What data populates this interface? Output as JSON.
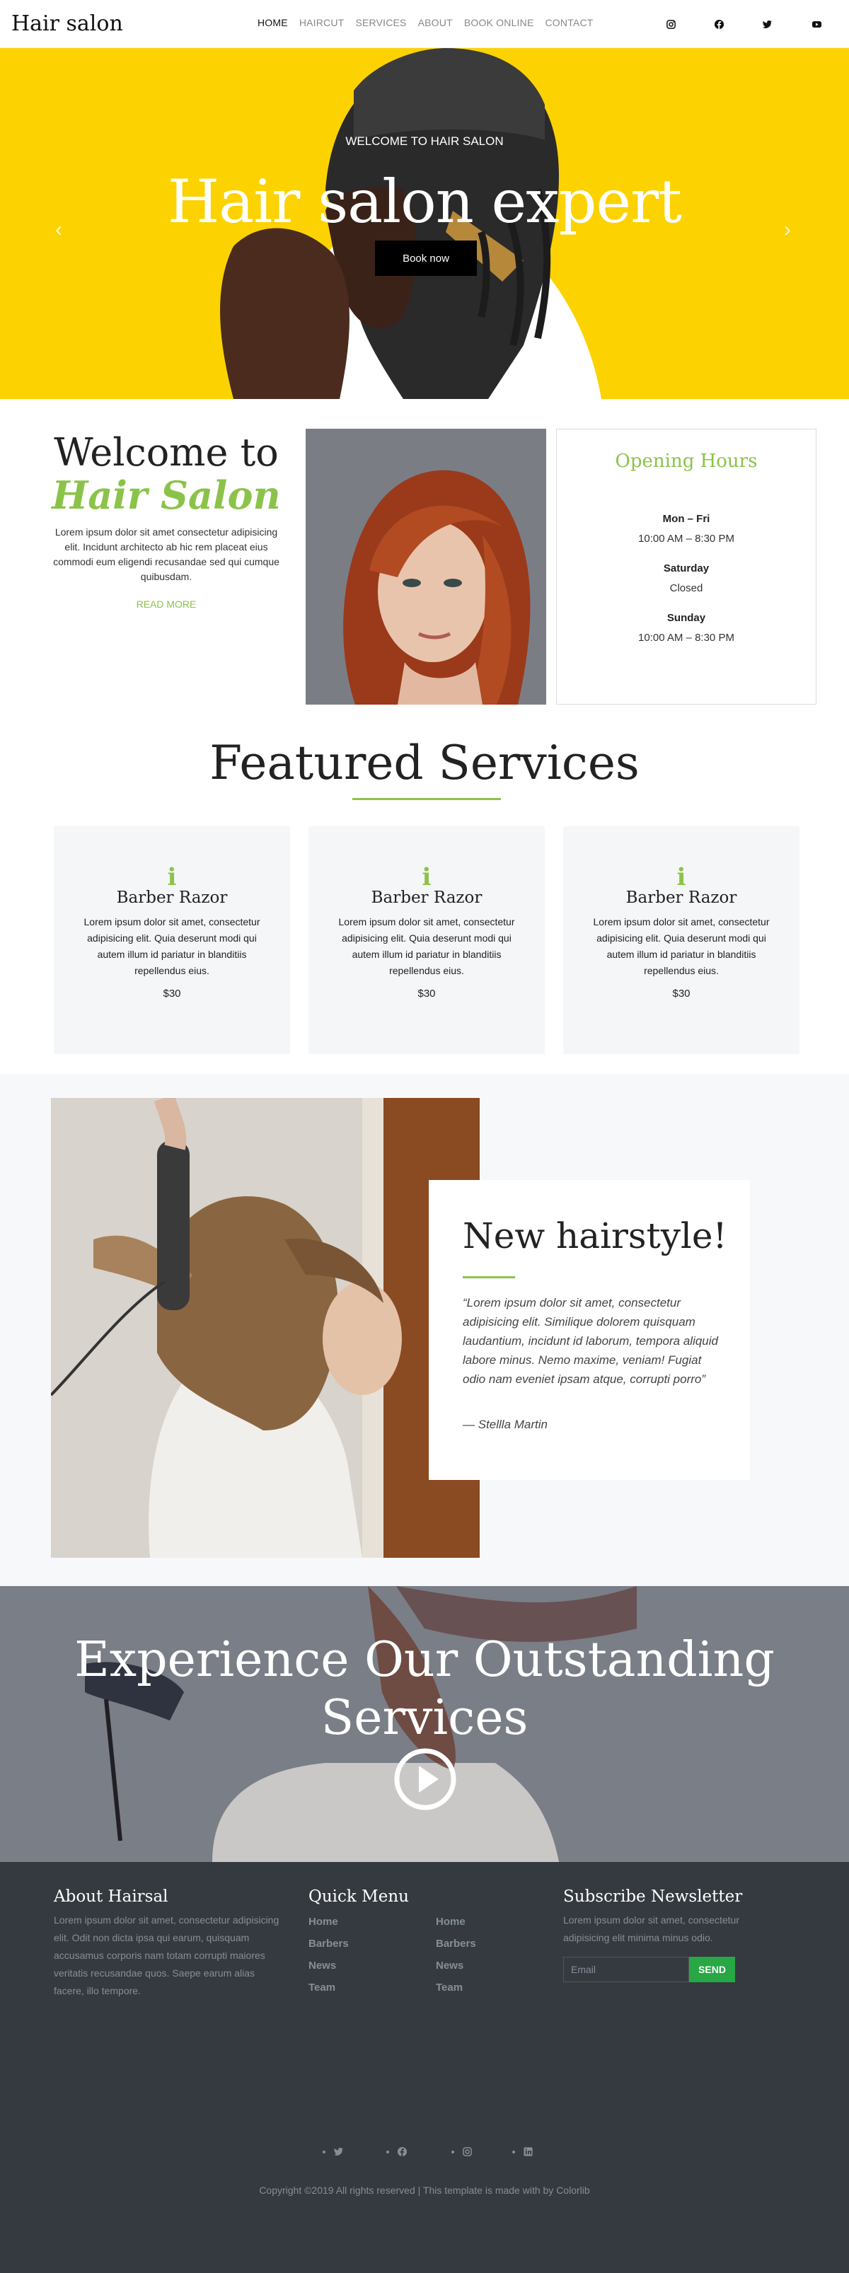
{
  "header": {
    "logo": "Hair salon",
    "nav": [
      "HOME",
      "HAIRCUT",
      "SERVICES",
      "ABOUT",
      "BOOK ONLINE",
      "CONTACT"
    ],
    "social_icons": [
      "instagram-icon",
      "facebook-icon",
      "twitter-icon",
      "youtube-icon"
    ]
  },
  "hero": {
    "subtitle": "WELCOME TO HAIR SALON",
    "title": "Hair salon expert",
    "button": "Book now",
    "prev": "‹",
    "next": "›",
    "background_color": "#fcd200"
  },
  "welcome": {
    "title_line1": "Welcome to",
    "title_line2": "Hair Salon",
    "text": "Lorem ipsum dolor sit amet consectetur adipisicing elit. Incidunt architecto ab hic rem placeat eius commodi eum eligendi recusandae sed qui cumque quibusdam.",
    "read_more": "READ MORE"
  },
  "hours": {
    "title": "Opening Hours",
    "rows": [
      {
        "day": "Mon – Fri",
        "time": "10:00 AM – 8:30 PM"
      },
      {
        "day": "Saturday",
        "time": "Closed"
      },
      {
        "day": "Sunday",
        "time": "10:00 AM – 8:30 PM"
      }
    ]
  },
  "featured": {
    "title": "Featured Services",
    "cards": [
      {
        "icon": "i",
        "title": "Barber Razor",
        "text": "Lorem ipsum dolor sit amet, consectetur adipisicing elit. Quia deserunt modi qui autem illum id pariatur in blanditiis repellendus eius.",
        "price": "$30"
      },
      {
        "icon": "i",
        "title": "Barber Razor",
        "text": "Lorem ipsum dolor sit amet, consectetur adipisicing elit. Quia deserunt modi qui autem illum id pariatur in blanditiis repellendus eius.",
        "price": "$30"
      },
      {
        "icon": "i",
        "title": "Barber Razor",
        "text": "Lorem ipsum dolor sit amet, consectetur adipisicing elit. Quia deserunt modi qui autem illum id pariatur in blanditiis repellendus eius.",
        "price": "$30"
      }
    ]
  },
  "new_style": {
    "title": "New hairstyle!",
    "quote": "“Lorem ipsum dolor sit amet, consectetur adipisicing elit. Similique dolorem quisquam laudantium, incidunt id laborum, tempora aliquid labore minus. Nemo maxime, veniam! Fugiat odio nam eveniet ipsam atque, corrupti porro”",
    "author": "— Stellla Martin"
  },
  "experience": {
    "title": "Experience Our Outstanding Services"
  },
  "footer": {
    "about_title": "About Hairsal",
    "about_text": "Lorem ipsum dolor sit amet, consectetur adipisicing elit. Odit non dicta ipsa qui earum, quisquam accusamus corporis nam totam corrupti maiores veritatis recusandae quos. Saepe earum alias facere, illo tempore.",
    "menu_title": "Quick Menu",
    "menu_col1": [
      "Home",
      "Barbers",
      "News",
      "Team"
    ],
    "menu_col2": [
      "Home",
      "Barbers",
      "News",
      "Team"
    ],
    "newsletter_title": "Subscribe Newsletter",
    "newsletter_text": "Lorem ipsum dolor sit amet, consectetur adipisicing elit minima minus odio.",
    "email_placeholder": "Email",
    "send": "SEND",
    "social_icons": [
      "twitter-icon",
      "facebook-icon",
      "instagram-icon",
      "linkedin-icon"
    ],
    "copyright": "Copyright ©2019 All rights reserved | This template is made with by Colorlib",
    "accent_color": "#28a745"
  },
  "colors": {
    "accent": "#8bc34a",
    "dark": "#343a40"
  }
}
